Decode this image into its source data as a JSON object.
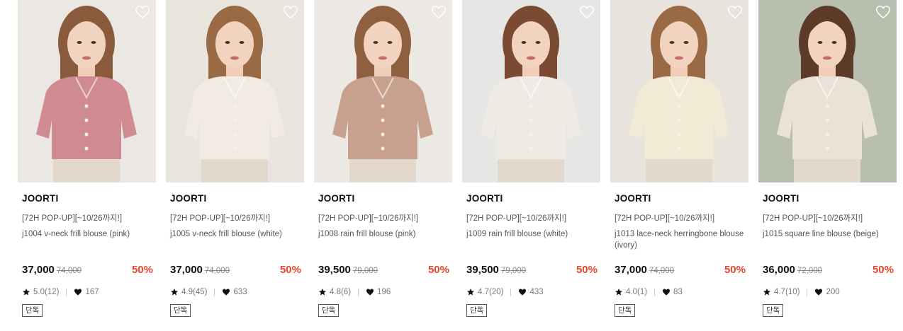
{
  "products": [
    {
      "brand": "JOORTI",
      "promo": "[72H POP-UP][~10/26까지!]",
      "name": "j1004 v-neck frill blouse (pink)",
      "price": "37,000",
      "original_price": "74,000",
      "discount": "50%",
      "rating": "5.0(12)",
      "likes": "167",
      "badge": "단독",
      "bg_color": "#ebe7e3",
      "top_color": "#cf8b91",
      "hair_color": "#8a5a3c"
    },
    {
      "brand": "JOORTI",
      "promo": "[72H POP-UP][~10/26까지!]",
      "name": "j1005 v-neck frill blouse (white)",
      "price": "37,000",
      "original_price": "74,000",
      "discount": "50%",
      "rating": "4.9(45)",
      "likes": "633",
      "badge": "단독",
      "bg_color": "#e9e4de",
      "top_color": "#f1ebe1",
      "hair_color": "#9a6a45"
    },
    {
      "brand": "JOORTI",
      "promo": "[72H POP-UP][~10/26까지!]",
      "name": "j1008 rain frill blouse (pink)",
      "price": "39,500",
      "original_price": "79,000",
      "discount": "50%",
      "rating": "4.8(6)",
      "likes": "196",
      "badge": "단독",
      "bg_color": "#ece8e3",
      "top_color": "#c8a08e",
      "hair_color": "#8e603f"
    },
    {
      "brand": "JOORTI",
      "promo": "[72H POP-UP][~10/26까지!]",
      "name": "j1009 rain frill blouse (white)",
      "price": "39,500",
      "original_price": "79,000",
      "discount": "50%",
      "rating": "4.7(20)",
      "likes": "433",
      "badge": "단독",
      "bg_color": "#e6e6e4",
      "top_color": "#efebe4",
      "hair_color": "#7a4a32"
    },
    {
      "brand": "JOORTI",
      "promo": "[72H POP-UP][~10/26까지!]",
      "name": "j1013 lace-neck herringbone blouse (ivory)",
      "price": "37,000",
      "original_price": "74,000",
      "discount": "50%",
      "rating": "4.0(1)",
      "likes": "83",
      "badge": "단독",
      "bg_color": "#e8e3dc",
      "top_color": "#f3ead6",
      "hair_color": "#9a6a45"
    },
    {
      "brand": "JOORTI",
      "promo": "[72H POP-UP][~10/26까지!]",
      "name": "j1015 square line blouse (beige)",
      "price": "36,000",
      "original_price": "72,000",
      "discount": "50%",
      "rating": "4.7(10)",
      "likes": "200",
      "badge": "단독",
      "bg_color": "#b9bfae",
      "top_color": "#eae2d6",
      "hair_color": "#5e3b28"
    }
  ],
  "icons": {
    "wishlist": "heart-outline-icon",
    "rating": "star-icon",
    "likes": "heart-filled-icon"
  },
  "colors": {
    "discount": "#e8452c",
    "text_muted": "#777777"
  }
}
